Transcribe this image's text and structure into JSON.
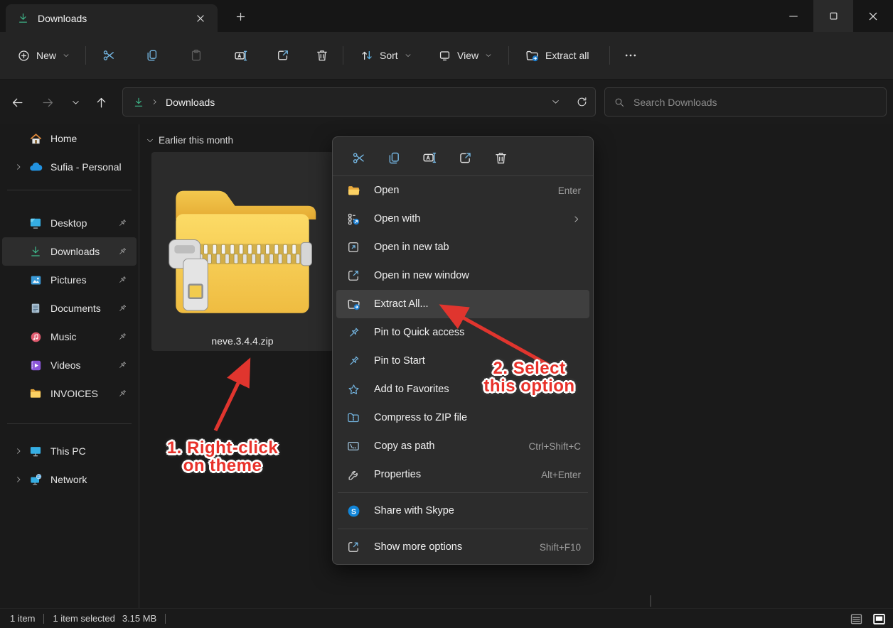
{
  "window": {
    "tab_title": "Downloads"
  },
  "toolbar": {
    "new_label": "New",
    "sort_label": "Sort",
    "view_label": "View",
    "extract_all_label": "Extract all"
  },
  "address_bar": {
    "breadcrumb": "Downloads",
    "search_placeholder": "Search Downloads"
  },
  "sidebar": {
    "items": [
      {
        "label": "Home",
        "icon": "home-icon"
      },
      {
        "label": "Sufia - Personal",
        "icon": "onedrive-cloud-icon",
        "expandable": true
      },
      {
        "label": "Desktop",
        "icon": "desktop-icon",
        "pinned": true
      },
      {
        "label": "Downloads",
        "icon": "download-icon",
        "pinned": true,
        "selected": true
      },
      {
        "label": "Pictures",
        "icon": "pictures-icon",
        "pinned": true
      },
      {
        "label": "Documents",
        "icon": "documents-icon",
        "pinned": true
      },
      {
        "label": "Music",
        "icon": "music-icon",
        "pinned": true
      },
      {
        "label": "Videos",
        "icon": "videos-icon",
        "pinned": true
      },
      {
        "label": "INVOICES",
        "icon": "folder-icon",
        "pinned": true
      },
      {
        "label": "This PC",
        "icon": "this-pc-icon",
        "expandable": true
      },
      {
        "label": "Network",
        "icon": "network-icon",
        "expandable": true
      }
    ]
  },
  "main": {
    "group_header": "Earlier this month",
    "file": {
      "name": "neve.3.4.4.zip",
      "type": "zip-archive"
    }
  },
  "context_menu": {
    "items": [
      {
        "label": "Open",
        "shortcut": "Enter",
        "icon": "folder-open-icon"
      },
      {
        "label": "Open with",
        "icon": "open-with-icon",
        "submenu": true
      },
      {
        "label": "Open in new tab",
        "icon": "open-new-tab-icon"
      },
      {
        "label": "Open in new window",
        "icon": "open-new-window-icon"
      },
      {
        "label": "Extract All...",
        "icon": "extract-all-icon",
        "highlighted": true
      },
      {
        "label": "Pin to Quick access",
        "icon": "pin-icon"
      },
      {
        "label": "Pin to Start",
        "icon": "pin-icon"
      },
      {
        "label": "Add to Favorites",
        "icon": "star-icon"
      },
      {
        "label": "Compress to ZIP file",
        "icon": "compress-zip-icon"
      },
      {
        "label": "Copy as path",
        "shortcut": "Ctrl+Shift+C",
        "icon": "copy-path-icon"
      },
      {
        "label": "Properties",
        "shortcut": "Alt+Enter",
        "icon": "wrench-icon"
      },
      {
        "label": "Share with Skype",
        "icon": "skype-icon"
      },
      {
        "label": "Show more options",
        "shortcut": "Shift+F10",
        "icon": "show-more-icon"
      }
    ]
  },
  "annotations": {
    "step1_line1": "1. Right-click",
    "step1_line2": "on theme",
    "step2_line1": "2. Select",
    "step2_line2": "this option"
  },
  "status_bar": {
    "items_count": "1 item",
    "selection": "1 item selected",
    "size": "3.15 MB"
  },
  "icons": {
    "download-icon": "arrow-down-over-bar",
    "search-icon": "magnifier",
    "cut-icon": "scissors",
    "copy-icon": "two-overlapping-rects",
    "paste-icon": "clipboard",
    "rename-icon": "box-with-A-and-cursor",
    "share-icon": "box-with-out-arrow",
    "delete-icon": "trash-can",
    "sort-icon": "up-down-arrows",
    "view-icon": "display-square",
    "more-icon": "three-dots",
    "refresh-icon": "circular-arrow",
    "pin-icon": "pushpin",
    "star-icon": "star-outline",
    "skype-icon": "blue-circle-S"
  },
  "colors": {
    "annotation_red": "#e8312a",
    "accent_blue": "#5fb3e4",
    "download_green": "#3fbf8f",
    "folder_yellow": "#f6c84a",
    "menu_highlight": "#3f3f3f"
  }
}
